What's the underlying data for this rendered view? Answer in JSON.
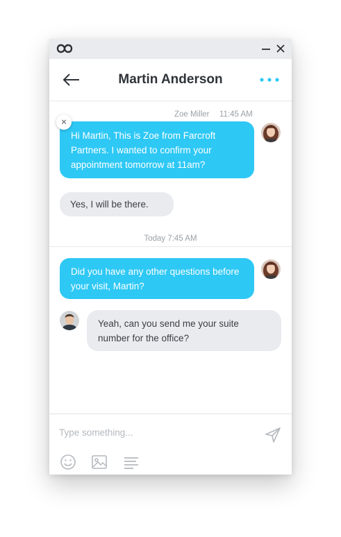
{
  "titlebar": {
    "logo_icon": "infinity-logo",
    "minimize_icon": "minimize-icon",
    "close_icon": "close-icon"
  },
  "header": {
    "back_icon": "arrow-left-icon",
    "contact_name": "Martin Anderson",
    "more_icon": "more-dots-icon",
    "accent": "#2ec8f5"
  },
  "messages": [
    {
      "sender": "Zoe Miller",
      "time": "11:45 AM",
      "text": "Hi Martin, This is Zoe from Farcroft Partners. I wanted to confirm your appointment tomorrow at 11am?",
      "direction": "outgoing"
    },
    {
      "text": "Yes, I will be there.",
      "direction": "incoming"
    }
  ],
  "day_separator": "Today 7:45 AM",
  "messages_today": [
    {
      "text": "Did you have any other questions before your visit, Martin?",
      "direction": "outgoing"
    },
    {
      "text": "Yeah, can you send me your suite number for the office?",
      "direction": "incoming"
    }
  ],
  "composer": {
    "placeholder": "Type something...",
    "value": "",
    "send_icon": "send-icon",
    "tools": [
      "emoji-icon",
      "image-icon",
      "text-format-icon"
    ]
  },
  "colors": {
    "outgoing_bubble": "#2ec8f5",
    "incoming_bubble": "#e9ebef",
    "titlebar": "#e9ebee"
  }
}
